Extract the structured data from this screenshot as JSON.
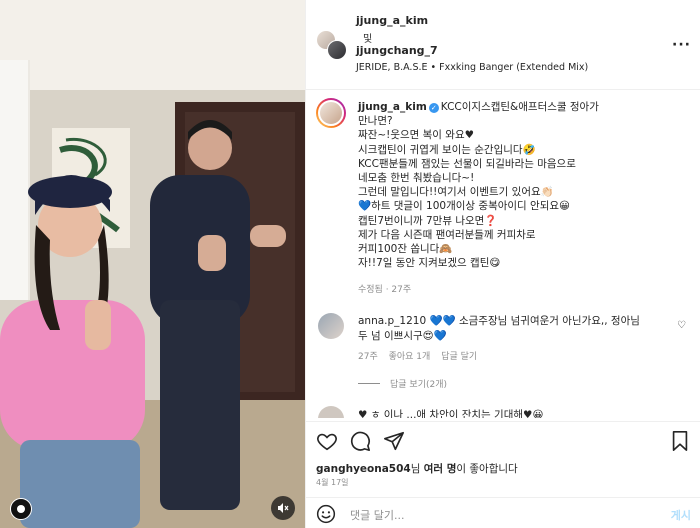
{
  "header": {
    "user1": "jjung_a_kim",
    "and": "및",
    "user2": "jjungchang_7",
    "audio": "JERIDE, B.A.S.E • Fxxking Banger (Extended Mix)"
  },
  "caption": {
    "username": "jjung_a_kim",
    "verified_icon": "✓",
    "lines": [
      "KCC이지스캡틴&애프터스쿨 정아가",
      "만나면?",
      "짜잔~!웃으면 복이 와요♥",
      "시크캡틴이 귀엽게 보이는 순간입니다🤣",
      "KCC팬분들께 잼있는 선물이 되길바라는 마음으로",
      "네모춤 한번 춰봤습니다~!",
      "그런데 말입니다!!여기서 이벤트기 있어요👏🏻",
      "💙하트 댓글이 100개이상 중복아이디 안되요😀",
      "캡틴7번이니까 7만뷰 나오면❓",
      "제가 다음 시즌때 팬여러분들께 커피차로",
      "커피100잔 쏩니다🙈",
      "자!!7일 동안 지켜보겠으 캡틴😋"
    ],
    "meta": "수정됨 · 27주"
  },
  "comment": {
    "username": "anna.p_1210",
    "line1": "💙💙 소금주장님 넘귀여운거 아닌가요,, 정아님",
    "line2": "두 넘 이쁘시구😍💙",
    "time": "27주",
    "likes": "좋아요 1개",
    "reply": "답글 달기",
    "view_replies": "답글 보기(2개)"
  },
  "partial_comment": "                    ♥  ㅎ  이나 ...애 차안이 잔치는 기대해♥😀",
  "likes": {
    "user": "ganghyeona504",
    "mid": "님 ",
    "others": "여러 명",
    "tail": "이 좋아합니다"
  },
  "date": "4월 17일",
  "composer": {
    "placeholder": "댓글 달기...",
    "post": "게시"
  },
  "icons": {
    "heart": "heart-icon",
    "comment": "comment-icon",
    "share": "send-icon",
    "save": "bookmark-icon",
    "emoji": "emoji-icon",
    "more": "more-icon",
    "mute": "mute-icon"
  },
  "colors": {
    "verified": "#3897f0",
    "post_disabled": "#b2dffc",
    "secondary_text": "#8e8e8e"
  }
}
